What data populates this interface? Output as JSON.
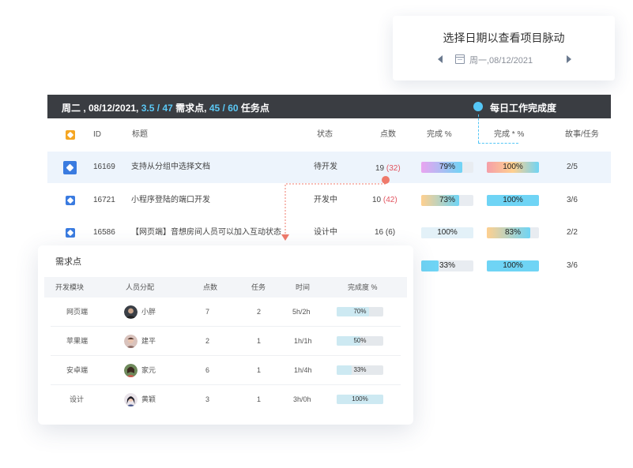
{
  "date_card": {
    "title": "选择日期以查看项目脉动",
    "date_display": "周一,08/12/2021"
  },
  "summary_bar": {
    "prefix": "周二 , 08/12/2021, ",
    "req_done": "3.5",
    "req_sep": " / ",
    "req_total": "47",
    "req_label": " 需求点, ",
    "task_done": "45",
    "task_sep": " / ",
    "task_total": "60",
    "task_label": " 任务点",
    "legend_label": "每日工作完成度"
  },
  "table": {
    "headers": {
      "id": "ID",
      "title": "标题",
      "status": "状态",
      "points": "点数",
      "done_pct": "完成 %",
      "done_star_pct": "完成 * %",
      "story_task": "故事/任务"
    },
    "rows": [
      {
        "id": "16169",
        "title": "支持从分组中选择文档",
        "status": "待开发",
        "points": "19",
        "points_extra": "(32)",
        "done_pct": 79,
        "done_label": "79%",
        "star_pct": 100,
        "star_label": "100%",
        "story_task": "2/5"
      },
      {
        "id": "16721",
        "title": "小程序登陆的端口开发",
        "status": "开发中",
        "points": "10",
        "points_extra": "(42)",
        "done_pct": 73,
        "done_label": "73%",
        "star_pct": 100,
        "star_label": "100%",
        "story_task": "3/6"
      },
      {
        "id": "16586",
        "title": "【网页端】音想房间人员可以加入互动状态",
        "status": "设计中",
        "points": "16",
        "points_extra": "(6)",
        "done_pct": 100,
        "done_label": "100%",
        "star_pct": 83,
        "star_label": "83%",
        "story_task": "2/2"
      },
      {
        "id": "",
        "title": "",
        "status": "",
        "points": "",
        "points_extra": "",
        "done_pct": 33,
        "done_label": "33%",
        "star_pct": 100,
        "star_label": "100%",
        "story_task": "3/6"
      }
    ]
  },
  "popup": {
    "title": "需求点",
    "headers": {
      "module": "开发模块",
      "assignee": "人员分配",
      "points": "点数",
      "tasks": "任务",
      "time": "时间",
      "completion": "完成度 %"
    },
    "rows": [
      {
        "module": "网页端",
        "name": "小胖",
        "points": "7",
        "tasks": "2",
        "time": "5h/2h",
        "pct": 70,
        "pct_label": "70%"
      },
      {
        "module": "苹果端",
        "name": "建平",
        "points": "2",
        "tasks": "1",
        "time": "1h/1h",
        "pct": 50,
        "pct_label": "50%"
      },
      {
        "module": "安卓端",
        "name": "家元",
        "points": "6",
        "tasks": "1",
        "time": "1h/4h",
        "pct": 33,
        "pct_label": "33%"
      },
      {
        "module": "设计",
        "name": "黄颖",
        "points": "3",
        "tasks": "1",
        "time": "3h/0h",
        "pct": 100,
        "pct_label": "100%"
      }
    ]
  },
  "colors": {
    "accent_blue": "#55c7f6",
    "dark_bar": "#3a3d42",
    "pink": "#eaa4f0",
    "orange_light": "#ffd08f",
    "red_accent": "#ef7a6b"
  }
}
